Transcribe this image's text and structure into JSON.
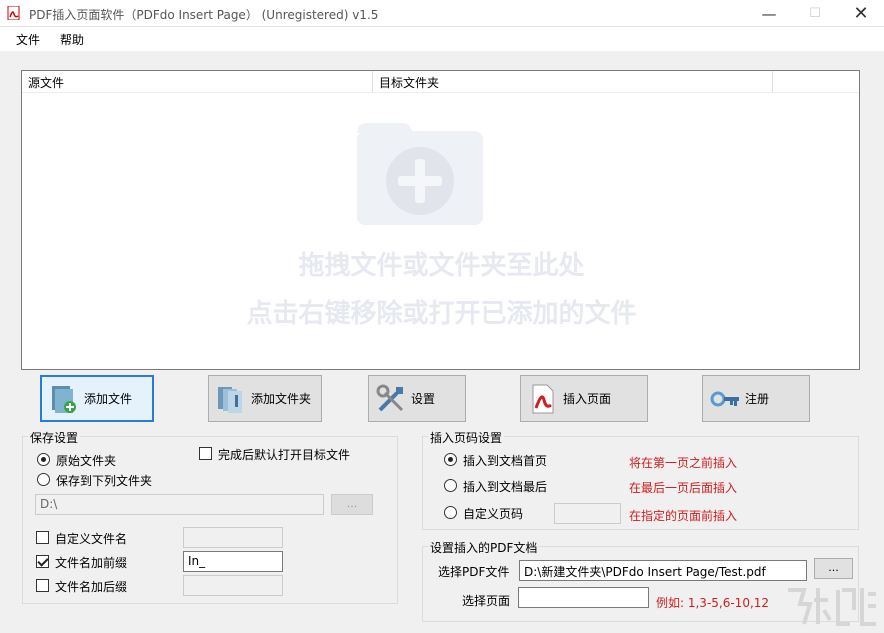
{
  "window": {
    "title": "PDF插入页面软件（PDFdo Insert Page） (Unregistered) v1.5",
    "minimize_icon": "minimize-icon",
    "maximize_icon": "maximize-icon",
    "close_icon": "close-icon"
  },
  "menu": {
    "items": [
      {
        "label": "文件"
      },
      {
        "label": "帮助"
      }
    ]
  },
  "file_list": {
    "columns": [
      "源文件",
      "目标文件夹"
    ],
    "placeholder_icon": "folder-add-icon",
    "drop_hint_line1": "拖拽文件或文件夹至此处",
    "drop_hint_line2": "点击右键移除或打开已添加的文件"
  },
  "toolbar": {
    "buttons": [
      {
        "label": "添加文件",
        "icon": "add-file-icon"
      },
      {
        "label": "添加文件夹",
        "icon": "add-folder-icon"
      },
      {
        "label": "设置",
        "icon": "settings-tools-icon"
      },
      {
        "label": "插入页面",
        "icon": "pdf-icon"
      },
      {
        "label": "注册",
        "icon": "key-icon"
      }
    ]
  },
  "save_settings": {
    "title": "保存设置",
    "option_original": "原始文件夹",
    "option_custom_folder": "保存到下列文件夹",
    "selected": "原始文件夹",
    "open_after": "完成后默认打开目标文件",
    "open_after_checked": false,
    "folder_path": "D:\\",
    "browse_label": "...",
    "custom_name_label": "自定义文件名",
    "custom_name_checked": false,
    "custom_name_value": "",
    "prefix_label": "文件名加前缀",
    "prefix_checked": true,
    "prefix_value": "In_",
    "suffix_label": "文件名加后缀",
    "suffix_checked": false,
    "suffix_value": ""
  },
  "insert_settings": {
    "title": "插入页码设置",
    "options": [
      {
        "label": "插入到文档首页",
        "hint": "将在第一页之前插入"
      },
      {
        "label": "插入到文档最后",
        "hint": "在最后一页后面插入"
      },
      {
        "label": "自定义页码",
        "hint": "在指定的页面前插入"
      }
    ],
    "selected": "插入到文档首页",
    "custom_page_value": ""
  },
  "pdf_settings": {
    "title": "设置插入的PDF文档",
    "select_file_label": "选择PDF文件",
    "file_path": "D:\\新建文件夹\\PDFdo Insert Page/Test.pdf",
    "browse_label": "...",
    "select_page_label": "选择页面",
    "page_value": "",
    "example": "例如: 1,3-5,6-10,12"
  },
  "colors": {
    "accent": "#2a7bd6",
    "hint_red": "#d01e1e",
    "window_bg": "#f0f0f0"
  }
}
